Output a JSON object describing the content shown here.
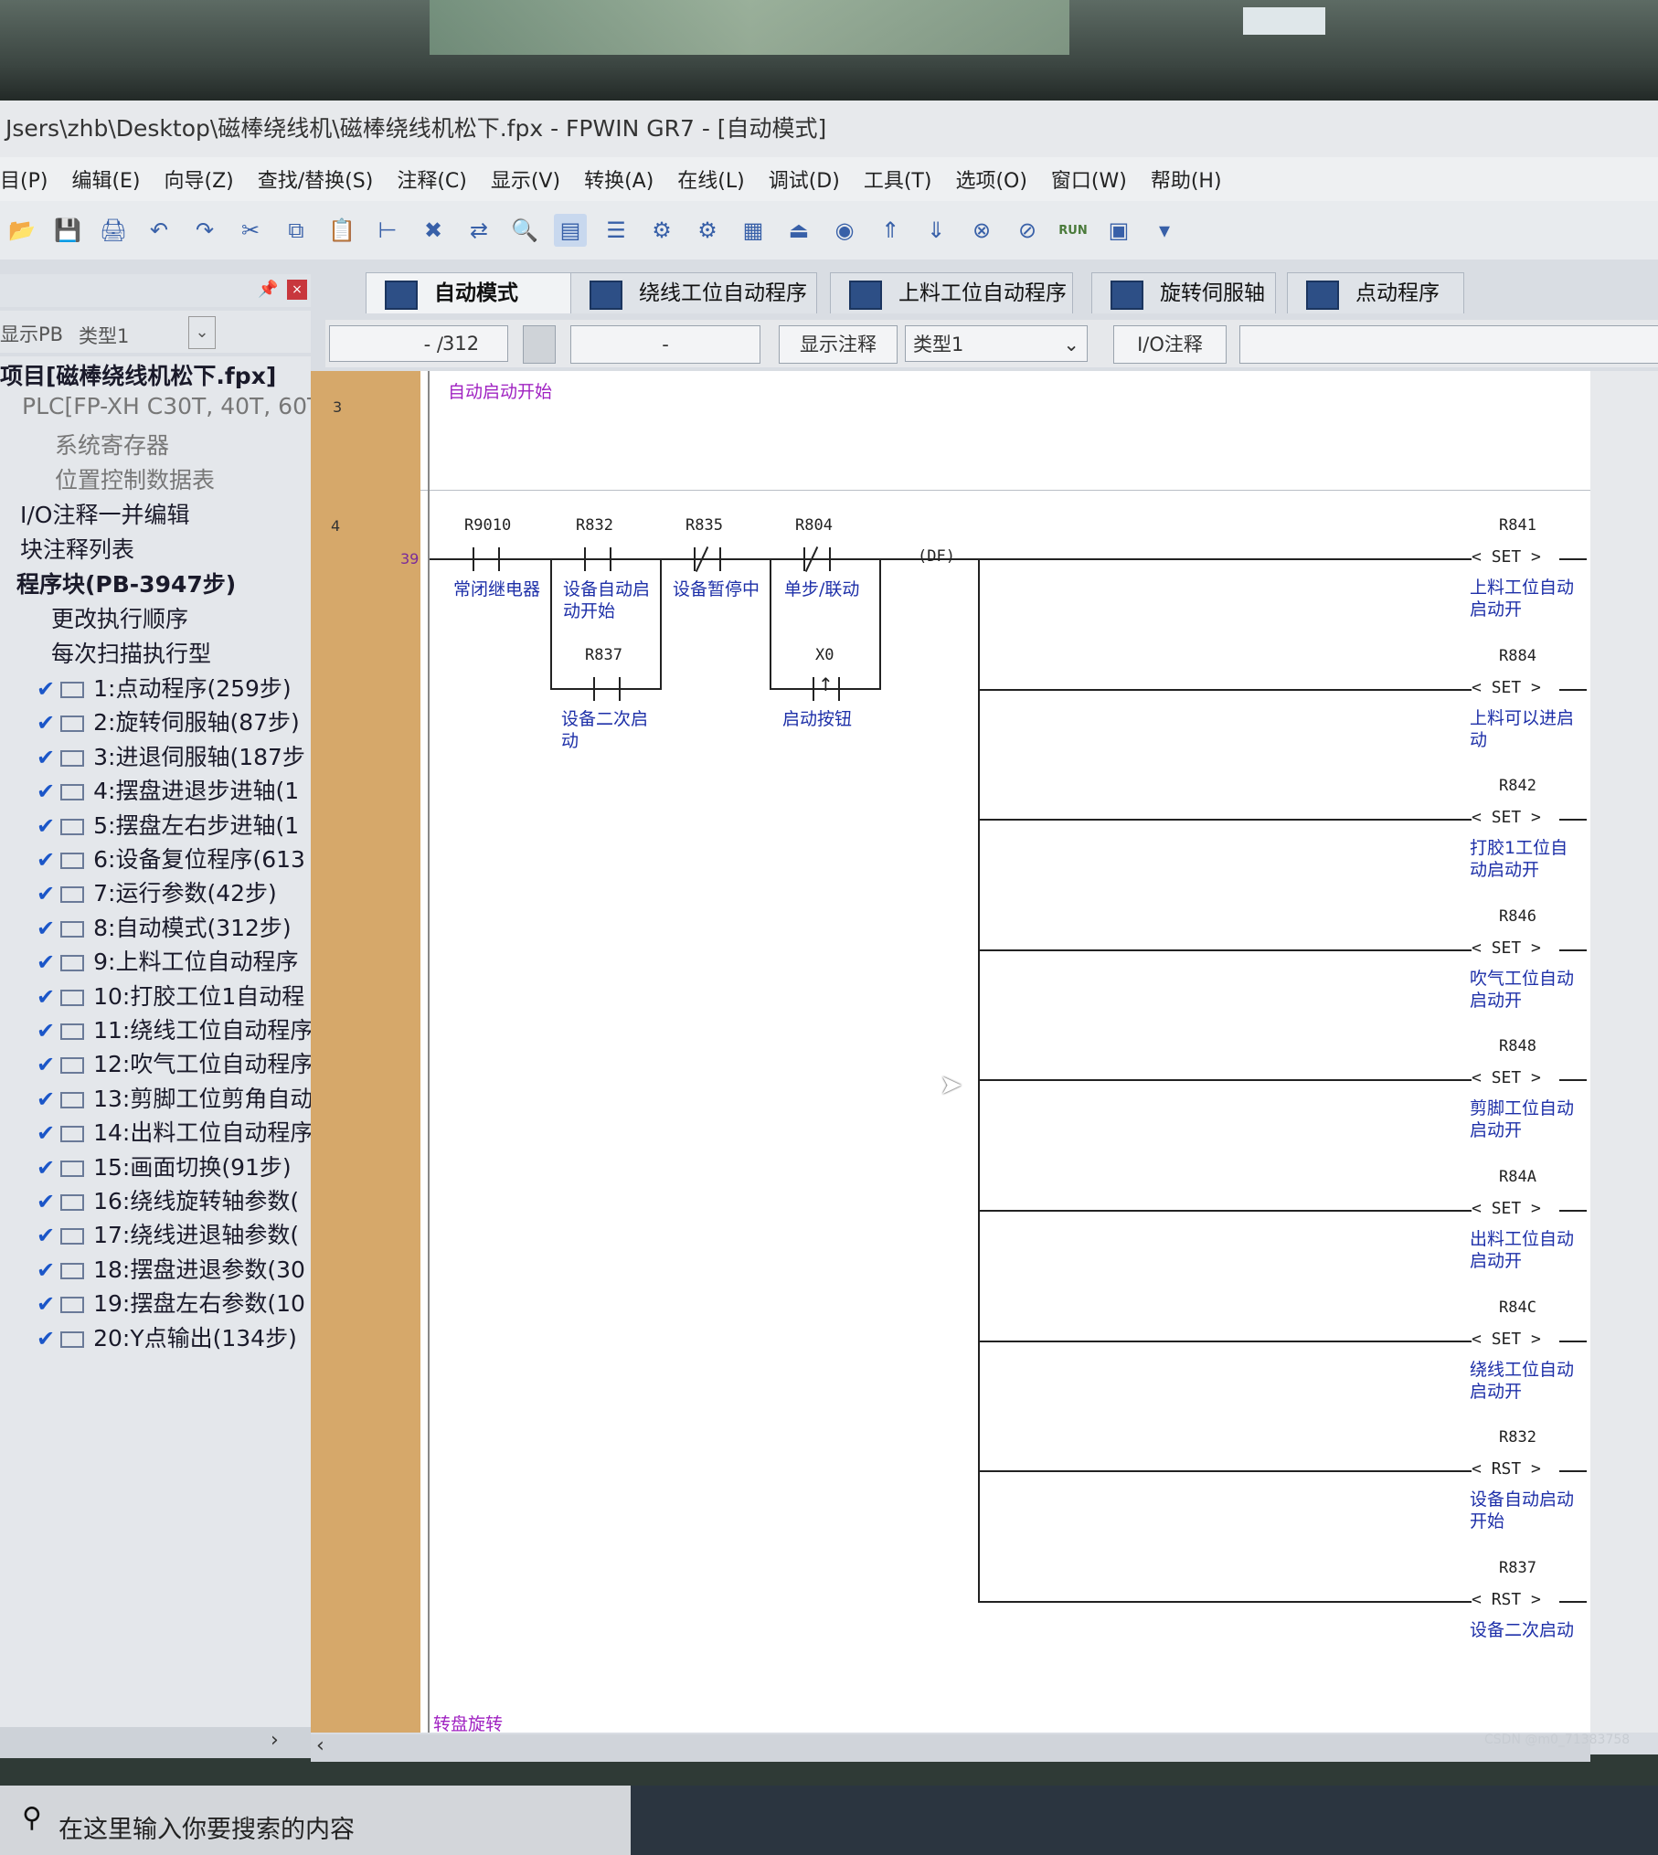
{
  "window": {
    "title": "Jsers\\zhb\\Desktop\\磁棒绕线机\\磁棒绕线机松下.fpx - FPWIN GR7 - [自动模式]"
  },
  "menu": [
    "目(P)",
    "编辑(E)",
    "向导(Z)",
    "查找/替换(S)",
    "注释(C)",
    "显示(V)",
    "转换(A)",
    "在线(L)",
    "调试(D)",
    "工具(T)",
    "选项(O)",
    "窗口(W)",
    "帮助(H)"
  ],
  "toolbar": {
    "run_label": "RUN"
  },
  "left_panel": {
    "filter_label": "显示PB",
    "filter_type": "类型1",
    "nodes": [
      "项目[磁棒绕线机松下.fpx]",
      "PLC[FP-XH C30T, 40T, 60T]",
      "系统寄存器",
      "位置控制数据表",
      "I/O注释一并编辑",
      "块注释列表",
      "程序块(PB-3947步)",
      "更改执行顺序",
      "每次扫描执行型"
    ],
    "programs": [
      "1:点动程序(259步)",
      "2:旋转伺服轴(87步)",
      "3:进退伺服轴(187步",
      "4:摆盘进退步进轴(1",
      "5:摆盘左右步进轴(1",
      "6:设备复位程序(613",
      "7:运行参数(42步)",
      "8:自动模式(312步)",
      "9:上料工位自动程序",
      "10:打胶工位1自动程",
      "11:绕线工位自动程序",
      "12:吹气工位自动程序",
      "13:剪脚工位剪角自动",
      "14:出料工位自动程序",
      "15:画面切换(91步)",
      "16:绕线旋转轴参数(",
      "17:绕线进退轴参数(",
      "18:摆盘进退参数(30",
      "19:摆盘左右参数(10",
      "20:Y点输出(134步)"
    ]
  },
  "tabs": [
    "自动模式",
    "绕线工位自动程序",
    "上料工位自动程序",
    "旋转伺服轴",
    "点动程序"
  ],
  "tab_close": "×",
  "status": {
    "position": "- /",
    "steps": "312",
    "mid": "-",
    "show_comment": "显示注释",
    "type": "类型1",
    "io_comment": "I/O注释"
  },
  "ladder": {
    "row3": {
      "num": "3",
      "comment": "自动启动开始"
    },
    "row4": {
      "num": "4",
      "step": "39"
    },
    "bottom_comment": "转盘旋转",
    "contacts": [
      {
        "addr": "R9010",
        "comment": "常闭继电器"
      },
      {
        "addr": "R832",
        "comment": "设备自动启动开始"
      },
      {
        "addr": "R835",
        "comment": "设备暂停中"
      },
      {
        "addr": "R804",
        "comment": "单步/联动"
      },
      {
        "addr": "R837",
        "comment": "设备二次启动"
      },
      {
        "addr": "X0",
        "comment": "启动按钮"
      }
    ],
    "df": "(DF)",
    "outputs": [
      {
        "addr": "R841",
        "op": "SET",
        "comment": "上料工位自动启动开"
      },
      {
        "addr": "R884",
        "op": "SET",
        "comment": "上料可以进启动"
      },
      {
        "addr": "R842",
        "op": "SET",
        "comment": "打胶1工位自动启动开"
      },
      {
        "addr": "R846",
        "op": "SET",
        "comment": "吹气工位自动启动开"
      },
      {
        "addr": "R848",
        "op": "SET",
        "comment": "剪脚工位自动启动开"
      },
      {
        "addr": "R84A",
        "op": "SET",
        "comment": "出料工位自动启动开"
      },
      {
        "addr": "R84C",
        "op": "SET",
        "comment": "绕线工位自动启动开"
      },
      {
        "addr": "R832",
        "op": "RST",
        "comment": "设备自动启动开始"
      },
      {
        "addr": "R837",
        "op": "RST",
        "comment": "设备二次启动"
      }
    ]
  },
  "taskbar": {
    "search_placeholder": "在这里输入你要搜索的内容"
  },
  "watermark": "CSDN @m0_71383758"
}
